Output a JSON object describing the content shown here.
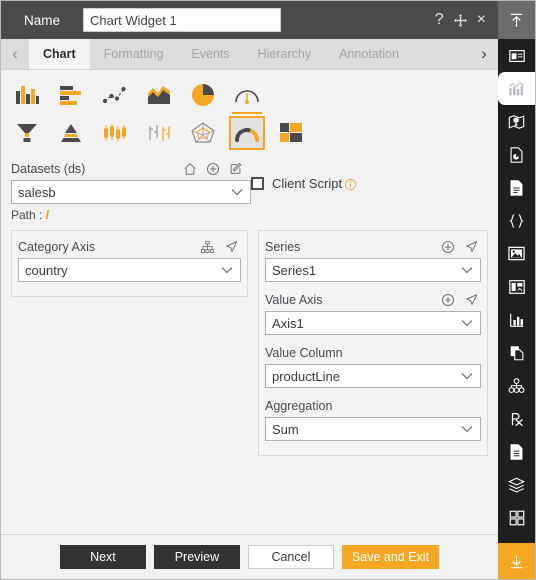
{
  "titlebar": {
    "name_label": "Name",
    "widget_name": "Chart Widget 1",
    "name_placeholder": "Chart Widget 1",
    "help_glyph": "?",
    "close_glyph": "×"
  },
  "tabs": {
    "prev_glyph": "‹",
    "next_glyph": "›",
    "items": [
      {
        "label": "Chart",
        "active": true
      },
      {
        "label": "Formatting",
        "active": false
      },
      {
        "label": "Events",
        "active": false
      },
      {
        "label": "Hierarchy",
        "active": false
      },
      {
        "label": "Annotation",
        "active": false
      }
    ]
  },
  "chart_types": {
    "row1": [
      {
        "name": "column-chart-icon",
        "selected": false
      },
      {
        "name": "bar-chart-icon",
        "selected": false
      },
      {
        "name": "scatter-line-chart-icon",
        "selected": false
      },
      {
        "name": "area-chart-icon",
        "selected": false
      },
      {
        "name": "pie-chart-icon",
        "selected": false
      },
      {
        "name": "gauge-chart-icon",
        "selected": false,
        "group_active": true
      }
    ],
    "row2": [
      {
        "name": "funnel-chart-icon",
        "selected": false
      },
      {
        "name": "pyramid-chart-icon",
        "selected": false
      },
      {
        "name": "candlestick-chart-icon",
        "selected": false
      },
      {
        "name": "ohlc-chart-icon",
        "selected": false
      },
      {
        "name": "radar-chart-icon",
        "selected": false
      },
      {
        "name": "arc-gauge-chart-icon",
        "selected": true
      },
      {
        "name": "treemap-chart-icon",
        "selected": false
      }
    ]
  },
  "datasets": {
    "label": "Datasets (ds)",
    "value": "salesb",
    "path_label": "Path :",
    "path_value": "/",
    "home_icon": "home-icon",
    "add_icon": "add-circle-icon",
    "edit_icon": "edit-icon"
  },
  "client_script": {
    "label": "Client Script",
    "checked": false,
    "info_icon": "info-icon"
  },
  "category_axis": {
    "label": "Category Axis",
    "value": "country",
    "hierarchy_icon": "hierarchy-icon",
    "navigate_icon": "navigate-icon"
  },
  "series": {
    "label": "Series",
    "value": "Series1",
    "add_icon": "add-circle-icon",
    "navigate_icon": "navigate-icon"
  },
  "value_axis": {
    "label": "Value Axis",
    "value": "Axis1",
    "add_icon": "add-circle-icon",
    "navigate_icon": "navigate-icon"
  },
  "value_column": {
    "label": "Value Column",
    "value": "productLine"
  },
  "aggregation": {
    "label": "Aggregation",
    "value": "Sum"
  },
  "footer": {
    "next": "Next",
    "preview": "Preview",
    "cancel": "Cancel",
    "save_exit": "Save and Exit"
  },
  "rail": {
    "top_icon": "collapse-up-icon",
    "bottom_icon": "download-icon",
    "items": [
      {
        "name": "widget-panel-icon",
        "active": false
      },
      {
        "name": "chart-icon",
        "active": true
      },
      {
        "name": "map-icon",
        "active": false
      },
      {
        "name": "report-page-icon",
        "active": false
      },
      {
        "name": "document-icon",
        "active": false
      },
      {
        "name": "code-braces-icon",
        "active": false
      },
      {
        "name": "image-icon",
        "active": false
      },
      {
        "name": "dashboard-icon",
        "active": false
      },
      {
        "name": "bar-chart-panel-icon",
        "active": false
      },
      {
        "name": "copy-page-icon",
        "active": false
      },
      {
        "name": "org-hierarchy-icon",
        "active": false
      },
      {
        "name": "prescription-icon",
        "active": false
      },
      {
        "name": "document-list-icon",
        "active": false
      },
      {
        "name": "layers-icon",
        "active": false
      },
      {
        "name": "apps-grid-icon",
        "active": false
      }
    ]
  },
  "colors": {
    "accent": "#f5a623",
    "titlebar": "#4b4b4b",
    "rail": "#1f1f1f",
    "dark_button": "#333333"
  }
}
